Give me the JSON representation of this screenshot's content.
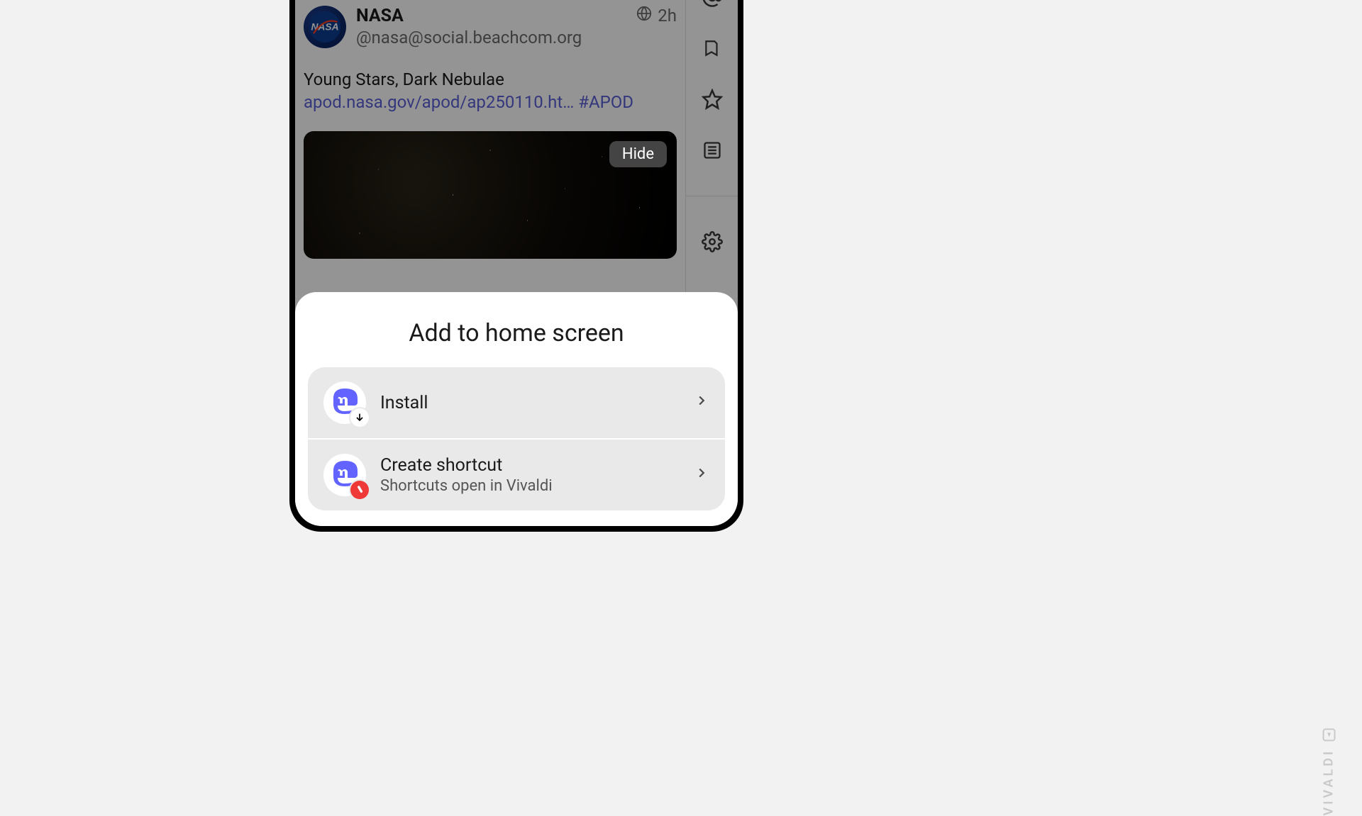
{
  "post": {
    "display_name": "NASA",
    "handle": "@nasa@social.beachcom.org",
    "time": "2h",
    "body_text": "Young Stars, Dark Nebulae",
    "link_text": "apod.nasa.gov/apod/ap250110.ht…",
    "hashtag": "#APOD",
    "hide_label": "Hide"
  },
  "sheet": {
    "title": "Add to home screen",
    "options": [
      {
        "title": "Install",
        "subtitle": ""
      },
      {
        "title": "Create shortcut",
        "subtitle": "Shortcuts open in Vivaldi"
      }
    ]
  },
  "watermark": "VIVALDI"
}
